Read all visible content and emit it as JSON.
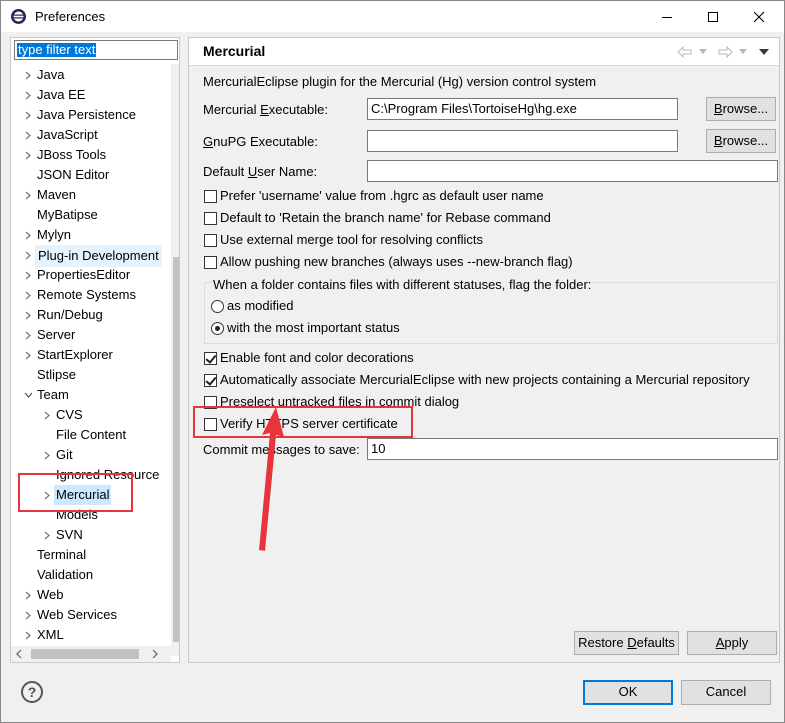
{
  "window": {
    "title": "Preferences"
  },
  "left": {
    "filter_text": "type filter text",
    "tree": [
      {
        "label": "Java",
        "level": 0,
        "arrow": true
      },
      {
        "label": "Java EE",
        "level": 0,
        "arrow": true
      },
      {
        "label": "Java Persistence",
        "level": 0,
        "arrow": true
      },
      {
        "label": "JavaScript",
        "level": 0,
        "arrow": true
      },
      {
        "label": "JBoss Tools",
        "level": 0,
        "arrow": true
      },
      {
        "label": "JSON Editor",
        "level": 0,
        "arrow": false
      },
      {
        "label": "Maven",
        "level": 0,
        "arrow": true
      },
      {
        "label": "MyBatipse",
        "level": 0,
        "arrow": false
      },
      {
        "label": "Mylyn",
        "level": 0,
        "arrow": true
      },
      {
        "label": "Plug-in Development",
        "level": 0,
        "arrow": true,
        "state": "hover"
      },
      {
        "label": "PropertiesEditor",
        "level": 0,
        "arrow": true
      },
      {
        "label": "Remote Systems",
        "level": 0,
        "arrow": true
      },
      {
        "label": "Run/Debug",
        "level": 0,
        "arrow": true
      },
      {
        "label": "Server",
        "level": 0,
        "arrow": true
      },
      {
        "label": "StartExplorer",
        "level": 0,
        "arrow": true
      },
      {
        "label": "Stlipse",
        "level": 0,
        "arrow": false
      },
      {
        "label": "Team",
        "level": 0,
        "arrow": "open"
      },
      {
        "label": "CVS",
        "level": 1,
        "arrow": true
      },
      {
        "label": "File Content",
        "level": 1,
        "arrow": false
      },
      {
        "label": "Git",
        "level": 1,
        "arrow": true
      },
      {
        "label": "Ignored Resource",
        "level": 1,
        "arrow": false
      },
      {
        "label": "Mercurial",
        "level": 1,
        "arrow": true,
        "state": "selected"
      },
      {
        "label": "Models",
        "level": 1,
        "arrow": false
      },
      {
        "label": "SVN",
        "level": 1,
        "arrow": true
      },
      {
        "label": "Terminal",
        "level": 0,
        "arrow": false
      },
      {
        "label": "Validation",
        "level": 0,
        "arrow": false
      },
      {
        "label": "Web",
        "level": 0,
        "arrow": true
      },
      {
        "label": "Web Services",
        "level": 0,
        "arrow": true
      },
      {
        "label": "XML",
        "level": 0,
        "arrow": true
      }
    ]
  },
  "right": {
    "title": "Mercurial",
    "description": "MercurialEclipse plugin for the Mercurial (Hg) version control system",
    "executable": {
      "label_pre": "Mercurial ",
      "label_u": "E",
      "label_post": "xecutable:",
      "value": "C:\\Program Files\\TortoiseHg\\hg.exe"
    },
    "gnupg": {
      "label_pre": "",
      "label_u": "G",
      "label_post": "nuPG Executable:",
      "value": ""
    },
    "username": {
      "label_pre": "Default ",
      "label_u": "U",
      "label_post": "ser Name:",
      "value": ""
    },
    "browse_label": {
      "pre": "",
      "u": "B",
      "post": "rowse..."
    },
    "checkboxes": [
      {
        "label": "Prefer 'username' value from .hgrc as default user name",
        "checked": false
      },
      {
        "label": "Default to 'Retain the branch name' for Rebase command",
        "checked": false
      },
      {
        "label": "Use external merge tool for resolving conflicts",
        "checked": false
      },
      {
        "label": "Allow pushing new branches (always uses --new-branch flag)",
        "checked": false
      }
    ],
    "group": {
      "label": "When a folder contains files with different statuses, flag the folder:",
      "options": [
        {
          "label": "as modified",
          "checked": false
        },
        {
          "label": "with the most important status",
          "checked": true
        }
      ]
    },
    "checkboxes2": [
      {
        "label": "Enable font and color decorations",
        "checked": true
      },
      {
        "label": "Automatically associate MercurialEclipse with new projects containing a Mercurial repository",
        "checked": true
      },
      {
        "label": "Preselect untracked files in commit dialog",
        "checked": false
      },
      {
        "label": "Verify HTTPS server certificate",
        "checked": false
      }
    ],
    "commit_label": "Commit messages to save:",
    "commit_value": "10",
    "restore_defaults": {
      "pre": "Restore ",
      "u": "D",
      "post": "efaults"
    },
    "apply": {
      "pre": "",
      "u": "A",
      "post": "pply"
    }
  },
  "footer": {
    "help": "?",
    "ok": "OK",
    "cancel": "Cancel"
  },
  "colors": {
    "annotation": "#e8353b",
    "selection": "#0078d7"
  }
}
